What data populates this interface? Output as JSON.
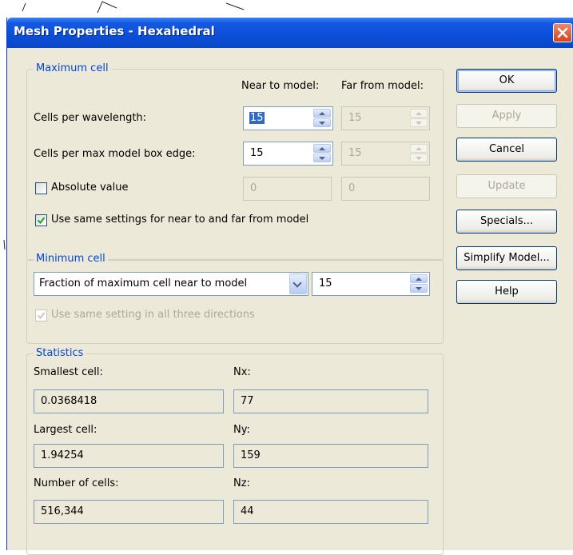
{
  "window": {
    "title": "Mesh Properties - Hexahedral"
  },
  "maximum_cell": {
    "group_title": "Maximum cell",
    "col_near": "Near to model:",
    "col_far": "Far from model:",
    "cells_per_wavelength": {
      "label": "Cells per wavelength:",
      "near": "15",
      "far": "15"
    },
    "cells_per_edge": {
      "label": "Cells per max model box edge:",
      "near": "15",
      "far": "15"
    },
    "absolute_value": {
      "label": "Absolute value",
      "checked": false,
      "near": "0",
      "far": "0"
    },
    "same_settings": {
      "label": "Use same settings for near to and far from model",
      "checked": true
    }
  },
  "minimum_cell": {
    "group_title": "Minimum cell",
    "mode": "Fraction of maximum cell near to model",
    "value": "15",
    "same_directions": {
      "label": "Use same setting in all three directions",
      "checked": true,
      "disabled": true
    }
  },
  "statistics": {
    "group_title": "Statistics",
    "smallest_label": "Smallest cell:",
    "smallest_value": "0.0368418",
    "largest_label": "Largest cell:",
    "largest_value": "1.94254",
    "count_label": "Number of cells:",
    "count_value": "516,344",
    "nx_label": "Nx:",
    "nx_value": "77",
    "ny_label": "Ny:",
    "ny_value": "159",
    "nz_label": "Nz:",
    "nz_value": "44"
  },
  "buttons": {
    "ok": "OK",
    "apply": "Apply",
    "cancel": "Cancel",
    "update": "Update",
    "specials": "Specials...",
    "simplify": "Simplify Model...",
    "help": "Help"
  },
  "colors": {
    "titlebar": "#0a4fd8",
    "group_title": "#0046d5",
    "dialog_bg": "#ece9d8"
  }
}
